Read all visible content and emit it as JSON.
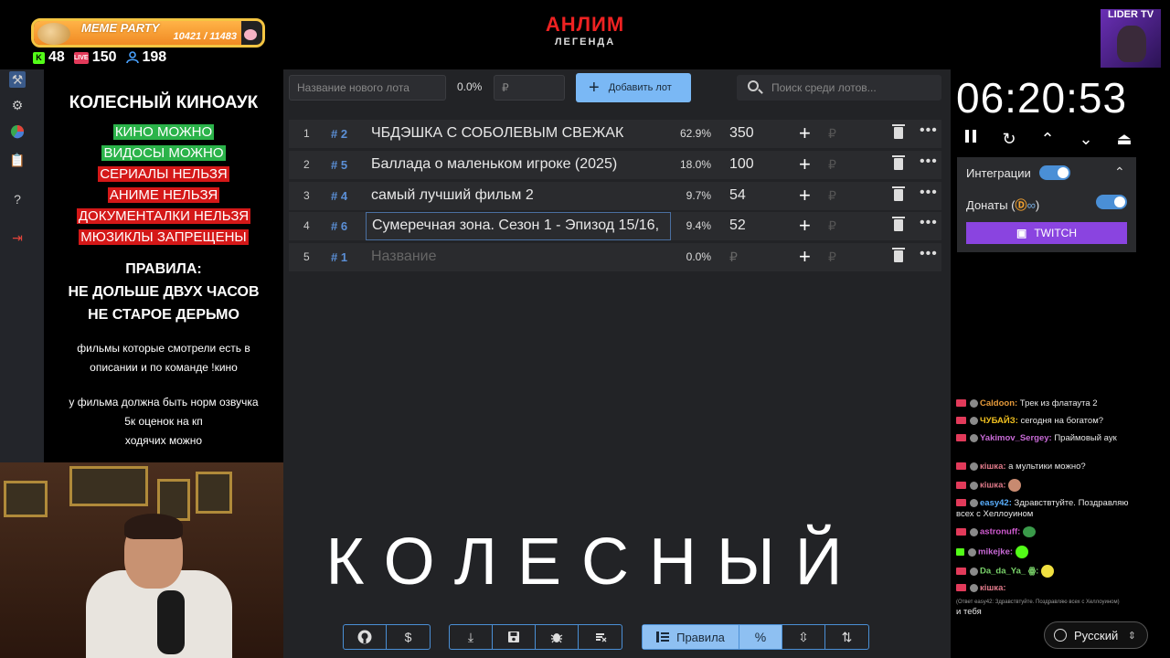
{
  "topbar": {
    "meme_title": "MEME PARTY",
    "meme_progress": "10421 / 11483",
    "meme_progress_fraction": 0.907,
    "stats": [
      {
        "icon": "kick-icon",
        "color": "#53fc18",
        "value": "48"
      },
      {
        "icon": "live-icon",
        "color": "#e23a5a",
        "value": "150"
      },
      {
        "icon": "user-icon",
        "color": "#4aa3ff",
        "value": "198"
      }
    ],
    "brand_top": "АНЛИМ",
    "brand_sub": "ЛЕГЕНДА",
    "lider": "LIDER TV"
  },
  "nav": {
    "items": [
      "hammer-icon",
      "gear-icon",
      "pie-chart-icon",
      "clipboard-icon",
      "help-icon",
      "logout-icon"
    ]
  },
  "rules": {
    "title": "КОЛЕСНЫЙ КИНОАУК",
    "tags": [
      {
        "text": "КИНО МОЖНО",
        "kind": "allowed",
        "color": "#2bb34a"
      },
      {
        "text": "ВИДОСЫ МОЖНО",
        "kind": "allowed",
        "color": "#2bb34a"
      },
      {
        "text": "СЕРИАЛЫ НЕЛЬЗЯ",
        "kind": "forbidden",
        "color": "#d41818"
      },
      {
        "text": "АНИМЕ НЕЛЬЗЯ",
        "kind": "forbidden",
        "color": "#d41818"
      },
      {
        "text": "ДОКУМЕНТАЛКИ НЕЛЬЗЯ",
        "kind": "forbidden",
        "color": "#d41818"
      },
      {
        "text": "МЮЗИКЛЫ ЗАПРЕЩЕНЫ",
        "kind": "forbidden",
        "color": "#d41818"
      }
    ],
    "heading1": "ПРАВИЛА:",
    "heading2": "НЕ ДОЛЬШЕ ДВУХ ЧАСОВ",
    "heading3": "НЕ СТАРОЕ ДЕРЬМО",
    "note1a": "фильмы которые смотрели есть в",
    "note1b": "описании и по команде !кино",
    "note2a": "у фильма должна быть норм озвучка",
    "note2b": "5к оценок на кп",
    "note2c": "ходячих можно"
  },
  "controls": {
    "new_lot_placeholder": "Название нового лота",
    "percent": "0.0%",
    "amount_placeholder": "₽",
    "add_label": "Добавить лот",
    "search_placeholder": "Поиск среди лотов..."
  },
  "lots": [
    {
      "num": "1",
      "id": "# 2",
      "name": "ЧБДЭШКА С СОБОЛЕВЫМ СВЕЖАК",
      "percent": "62.9%",
      "amount": "350"
    },
    {
      "num": "2",
      "id": "# 5",
      "name": "Баллада о маленьком игроке (2025)",
      "percent": "18.0%",
      "amount": "100"
    },
    {
      "num": "3",
      "id": "# 4",
      "name": "самый лучший фильм 2",
      "percent": "9.7%",
      "amount": "54"
    },
    {
      "num": "4",
      "id": "# 6",
      "name": "Сумеречная зона. Сезон 1 - Эпизод 15/16,",
      "percent": "9.4%",
      "amount": "52"
    },
    {
      "num": "5",
      "id": "# 1",
      "name": "Название",
      "percent": "0.0%",
      "amount": "₽"
    }
  ],
  "lot_currency": "₽",
  "overlay_word": "КОЛЕСНЫЙ",
  "bottom": {
    "group1": [
      "github-icon",
      "dollar-icon"
    ],
    "group2": [
      "download-icon",
      "save-icon",
      "bug-icon",
      "clear-icon"
    ],
    "rules_label": "Правила",
    "percent_symbol": "%"
  },
  "timer": {
    "value": "06:20:53",
    "controls": [
      "pause-icon",
      "restart-icon",
      "chevron-up-icon",
      "chevron-down-icon",
      "collapse-icon"
    ]
  },
  "integrations": {
    "label": "Интеграции",
    "donations_label": "Донаты (",
    "donations_close": ")",
    "twitch_label": "TWITCH"
  },
  "chat": [
    {
      "user": "Caldoon:",
      "color": "#e69a3a",
      "text": " Трек из флатаута 2"
    },
    {
      "user": "ЧУБАЙЗ:",
      "color": "#f0c020",
      "text": " сегодня на богатом?"
    },
    {
      "user": "Yakimov_Sergey:",
      "color": "#c86ad6",
      "text": " Праймовый аук"
    },
    {
      "user": "кiшка:",
      "color": "#e07a8a",
      "text": " а мультики можно?"
    },
    {
      "user": "кiшка:",
      "color": "#e07a8a",
      "text": ""
    },
    {
      "user": "easy42:",
      "color": "#5ab0ff",
      "text": " Здравствтуйте. Поздравляю всех с Хеллоуином"
    },
    {
      "user": "astronuff:",
      "color": "#d05ad0",
      "text": ""
    },
    {
      "user": "mikejke:",
      "color": "#c86ad6",
      "text": ""
    },
    {
      "user": "Da_da_Ya_ ꙮ:",
      "color": "#7ad36a",
      "text": ""
    },
    {
      "user": "кiшка:",
      "color": "#e07a8a",
      "text": ""
    }
  ],
  "chat_reply": "(Ответ easy42: Здравствтуйте. Поздравляю всех с Хеллоуином)",
  "chat_last": "и тебя",
  "language": "Русский"
}
